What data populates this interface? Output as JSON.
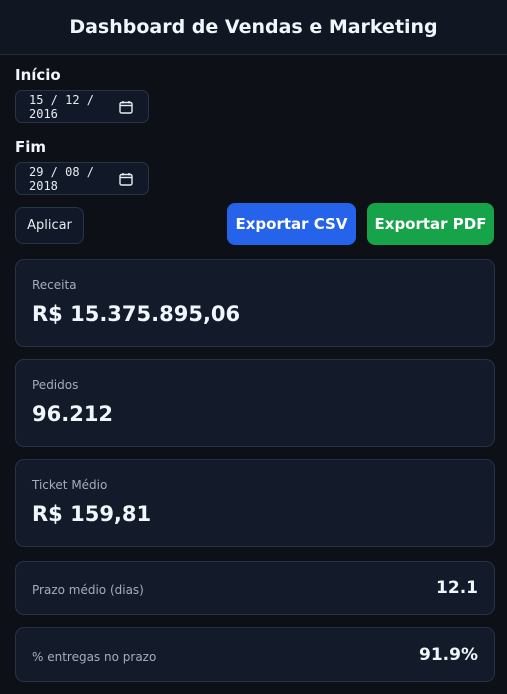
{
  "header": {
    "title": "Dashboard de Vendas e Marketing"
  },
  "filters": {
    "start_label": "Início",
    "start_value": "15 / 12 / 2016",
    "end_label": "Fim",
    "end_value": "29 / 08 / 2018"
  },
  "actions": {
    "apply_label": "Aplicar",
    "export_csv_label": "Exportar CSV",
    "export_pdf_label": "Exportar PDF"
  },
  "kpis": [
    {
      "label": "Receita",
      "value": "R$ 15.375.895,06"
    },
    {
      "label": "Pedidos",
      "value": "96.212"
    },
    {
      "label": "Ticket Médio",
      "value": "R$ 159,81"
    }
  ],
  "metrics": [
    {
      "label": "Prazo médio (dias)",
      "value": "12.1"
    },
    {
      "label": "% entregas no prazo",
      "value": "91.9%"
    }
  ],
  "colors": {
    "background": "#0d1117",
    "card": "#131b2b",
    "csv_button": "#2563eb",
    "pdf_button": "#16a34a"
  },
  "icons": {
    "date_picker": "calendar-icon"
  }
}
